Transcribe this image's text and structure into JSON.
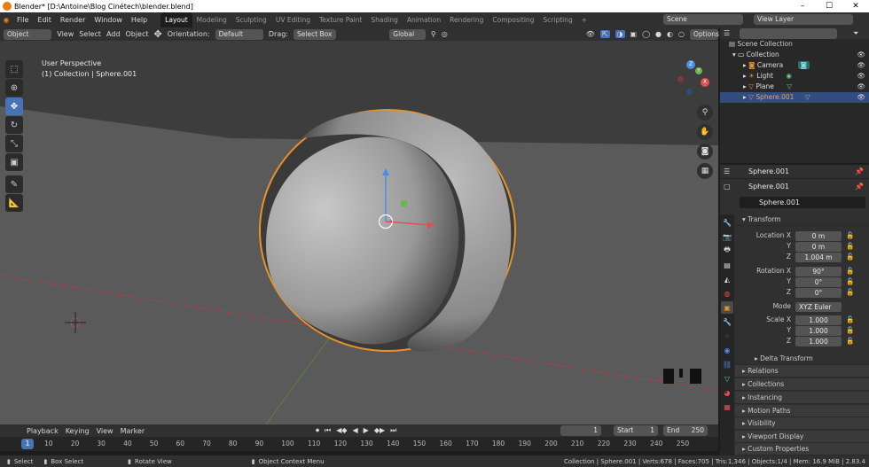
{
  "title": "Blender* [D:\\Antoine\\Blog Cinétech\\blender.blend]",
  "menu": [
    "File",
    "Edit",
    "Render",
    "Window",
    "Help"
  ],
  "workspaces": [
    "Layout",
    "Modeling",
    "Sculpting",
    "UV Editing",
    "Texture Paint",
    "Shading",
    "Animation",
    "Rendering",
    "Compositing",
    "Scripting"
  ],
  "add_tab": "+",
  "scene": "Scene",
  "view_layer": "View Layer",
  "header": {
    "mode": "Object Mode",
    "view": "View",
    "select": "Select",
    "add": "Add",
    "object": "Object",
    "orientation_label": "Orientation:",
    "orientation": "Default",
    "drag_label": "Drag:",
    "drag": "Select Box",
    "transform": "Global",
    "options": "Options"
  },
  "viewport": {
    "perspective": "User Perspective",
    "collection": "(1) Collection | Sphere.001"
  },
  "gizmo": {
    "x": "X",
    "y": "Y",
    "z": "Z"
  },
  "outliner": {
    "root": "Scene Collection",
    "items": [
      {
        "label": "Collection"
      },
      {
        "label": "Camera"
      },
      {
        "label": "Light"
      },
      {
        "label": "Plane"
      },
      {
        "label": "Sphere.001"
      }
    ]
  },
  "props": {
    "object_name": "Sphere.001",
    "data_name": "Sphere.001",
    "field_name": "Sphere.001",
    "transform": "Transform",
    "location_label": "Location X",
    "y_label": "Y",
    "z_label": "Z",
    "loc": [
      "0 m",
      "0 m",
      "1.004 m"
    ],
    "rotation_label": "Rotation X",
    "rot": [
      "90°",
      "0°",
      "0°"
    ],
    "mode_label": "Mode",
    "mode": "XYZ Euler",
    "scale_label": "Scale X",
    "scale": [
      "1.000",
      "1.000",
      "1.000"
    ],
    "sections": [
      "Delta Transform",
      "Relations",
      "Collections",
      "Instancing",
      "Motion Paths",
      "Visibility",
      "Viewport Display",
      "Custom Properties"
    ]
  },
  "timeline": {
    "playback": "Playback",
    "keying": "Keying",
    "view": "View",
    "marker": "Marker",
    "current": "1",
    "start_label": "Start",
    "start": "1",
    "end_label": "End",
    "end": "250",
    "cursor_frame": "1",
    "ticks": [
      "10",
      "20",
      "30",
      "40",
      "50",
      "60",
      "70",
      "80",
      "90",
      "100",
      "110",
      "120",
      "130",
      "140",
      "150",
      "160",
      "170",
      "180",
      "190",
      "200",
      "210",
      "220",
      "230",
      "240",
      "250"
    ]
  },
  "status": {
    "select": "Select",
    "box_select": "Box Select",
    "rotate": "Rotate View",
    "context": "Object Context Menu",
    "info": "Collection | Sphere.001 | Verts:678 | Faces:705 | Tris:1,346 | Objects:1/4 | Mem: 16.9 MiB | 2.83.4"
  }
}
